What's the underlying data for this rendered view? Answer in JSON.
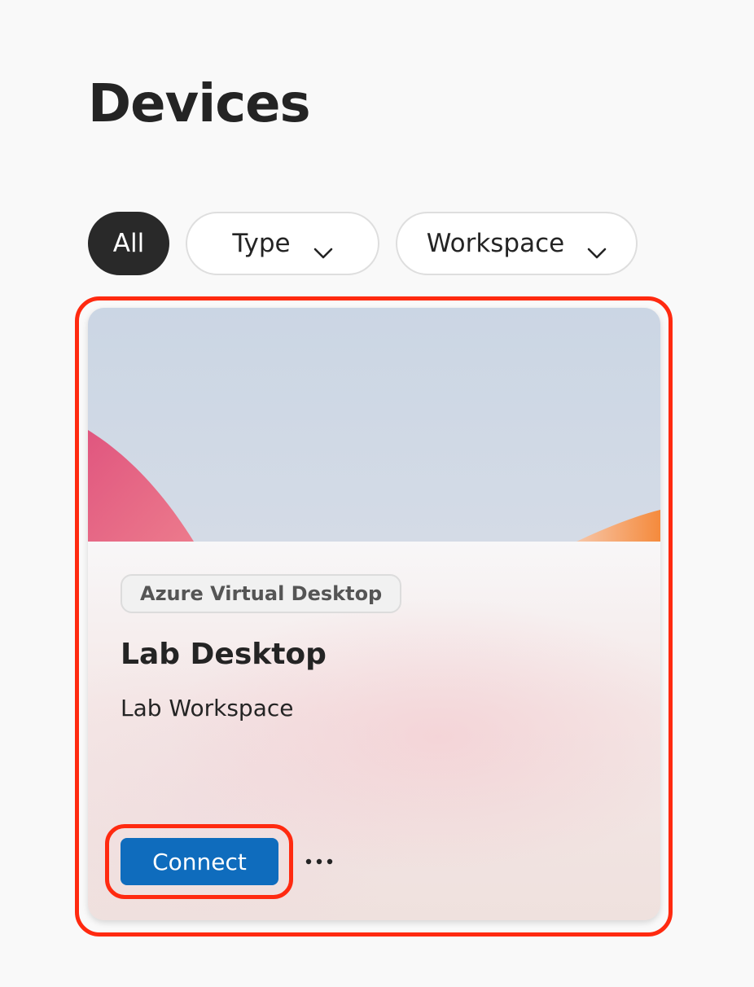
{
  "page": {
    "title": "Devices"
  },
  "filters": {
    "all_label": "All",
    "type_label": "Type",
    "workspace_label": "Workspace"
  },
  "device_card": {
    "badge": "Azure Virtual Desktop",
    "name": "Lab Desktop",
    "workspace": "Lab Workspace",
    "connect_label": "Connect",
    "more_icon": "more-horizontal-icon"
  },
  "colors": {
    "accent": "#0f6cbd",
    "highlight": "#ff2a10",
    "chip_selected": "#292929"
  }
}
